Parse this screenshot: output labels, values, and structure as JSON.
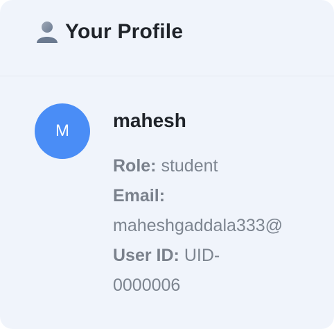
{
  "header": {
    "icon": "user-icon",
    "title": "Your Profile"
  },
  "profile": {
    "avatar_initial": "M",
    "avatar_color": "#4a8df6",
    "username": "mahesh",
    "role_label": "Role:",
    "role_value": "student",
    "email_label": "Email:",
    "email_value": "maheshgaddala333@",
    "userid_label": "User ID:",
    "userid_value_part1": "UID-",
    "userid_value_part2": "0000006"
  }
}
